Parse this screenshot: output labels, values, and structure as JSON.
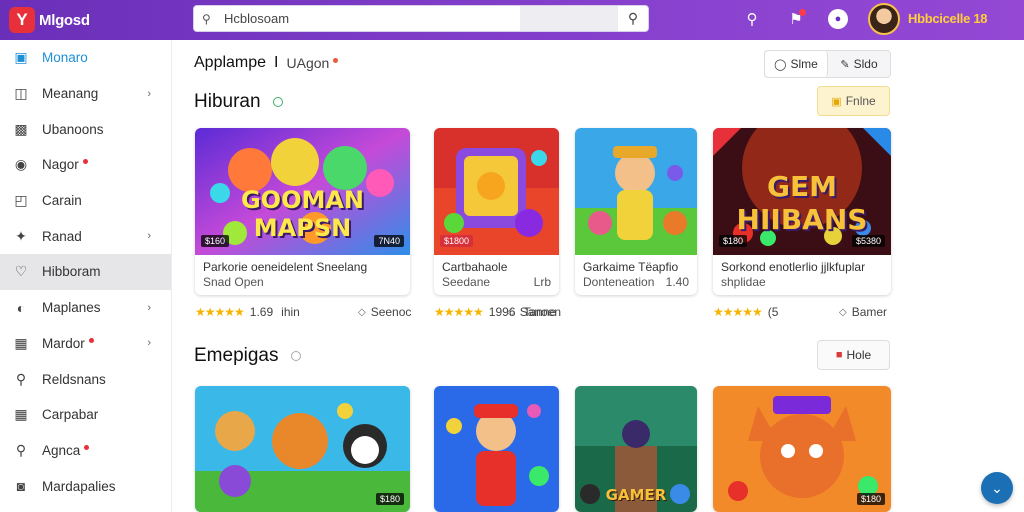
{
  "app": {
    "logo_mark": "Y",
    "logo_text": "Mlgosd"
  },
  "search": {
    "placeholder": "Hcblosoam",
    "value": "Hcblosoam"
  },
  "user": {
    "name": "Hbbcicelle 18"
  },
  "sidebar": {
    "items": [
      {
        "label": "Monaro",
        "icon": "home-icon",
        "active": true,
        "chevron": false,
        "badge": false
      },
      {
        "label": "Meanang",
        "icon": "inbox-icon",
        "chevron": true,
        "badge": false
      },
      {
        "label": "Ubanoons",
        "icon": "tv-icon",
        "chevron": false,
        "badge": false
      },
      {
        "label": "Nagor",
        "icon": "game-icon",
        "chevron": false,
        "badge": true
      },
      {
        "label": "Carain",
        "icon": "chart-icon",
        "chevron": false,
        "badge": false
      },
      {
        "label": "Ranad",
        "icon": "tools-icon",
        "chevron": true,
        "badge": false
      },
      {
        "label": "Hibboram",
        "icon": "heart-icon",
        "chevron": false,
        "badge": false,
        "highlight": true
      },
      {
        "label": "Maplanes",
        "icon": "compass-icon",
        "chevron": true,
        "badge": false
      },
      {
        "label": "Mardor",
        "icon": "puzzle-icon",
        "chevron": true,
        "badge": true
      },
      {
        "label": "Reldsnans",
        "icon": "location-icon",
        "chevron": false,
        "badge": false
      },
      {
        "label": "Carpabar",
        "icon": "grid-icon",
        "chevron": false,
        "badge": false
      },
      {
        "label": "Agnca",
        "icon": "pin-icon",
        "chevron": false,
        "badge": true
      },
      {
        "label": "Mardapalies",
        "icon": "people-icon",
        "chevron": false,
        "badge": false
      }
    ]
  },
  "header": {
    "title": "Applampe",
    "separator": "I",
    "subtitle": "UAgon"
  },
  "view_toggle": {
    "option1": "Slme",
    "option2": "Sldo"
  },
  "sections": {
    "first": {
      "title": "Hiburan",
      "button": "Fnlne"
    },
    "second": {
      "title": "Emepigas",
      "button": "Hole"
    }
  },
  "cards_row1": [
    {
      "line1": "Parkorie oeneidelent Sneelang",
      "line2": "Snad Open",
      "line2_right": "",
      "badge_left": "$160",
      "badge_right": "7N40",
      "thumb_title": "GOOMAN MAPSN",
      "rating": "1.69",
      "rating_extra": "ihin",
      "tag": "Seenoc"
    },
    {
      "line1": "Cartbahaole",
      "line2": "Seedane",
      "line2_right": "Lrb",
      "badge_left": "$1800",
      "badge_right": "",
      "thumb_title": "",
      "rating": "1996",
      "rating_extra": "Tanne",
      "tag": "Sanoen"
    },
    {
      "line1": "Garkaime Tёapfio",
      "line2": "Donteneation",
      "line2_right": "1.40",
      "badge_left": "",
      "badge_right": "",
      "thumb_title": "",
      "rating": "",
      "rating_extra": "",
      "tag": ""
    },
    {
      "line1": "Sorkond enotlerlio jjlkfuplar",
      "line2": "shplidae",
      "line2_right": "",
      "badge_left": "$180",
      "badge_right": "$5380",
      "thumb_title": "GEM HIIBANS",
      "rating": "(5",
      "rating_extra": "",
      "tag": "Bamer"
    }
  ],
  "cards_row2": [
    {
      "badge_right": "$180",
      "thumb_title": ""
    },
    {
      "badge_right": "",
      "thumb_title": ""
    },
    {
      "badge_right": "",
      "thumb_title": "GAMER"
    },
    {
      "badge_right": "$180",
      "thumb_title": ""
    }
  ],
  "fab": {
    "icon": "chevron-down-icon"
  },
  "colors": {
    "topbar": "#7d3bc6",
    "accent": "#1e8fd6",
    "star": "#f5b400",
    "brand_red": "#e8303a"
  }
}
